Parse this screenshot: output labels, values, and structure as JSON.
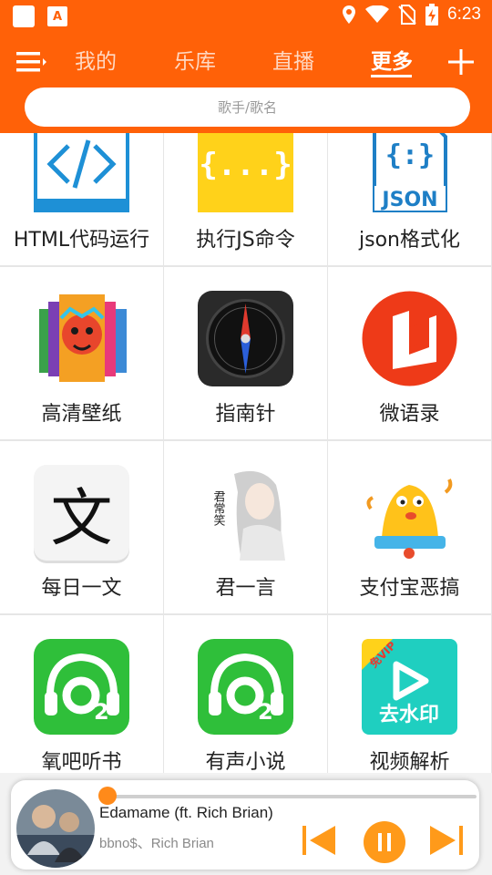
{
  "colors": {
    "brand": "#ff6108",
    "accent": "#ff9a1a"
  },
  "status_bar": {
    "time": "6:23",
    "icons": [
      "location-icon",
      "wifi-icon",
      "no-sim-icon",
      "battery-charging-icon"
    ]
  },
  "nav": {
    "tabs": [
      {
        "label": "我的"
      },
      {
        "label": "乐库"
      },
      {
        "label": "直播"
      },
      {
        "label": "更多",
        "active": true
      }
    ]
  },
  "search": {
    "placeholder": "歌手/歌名"
  },
  "apps": [
    {
      "label": "HTML代码运行",
      "icon": "html-code-icon"
    },
    {
      "label": "执行JS命令",
      "icon": "js-braces-icon"
    },
    {
      "label": "json格式化",
      "icon": "json-file-icon"
    },
    {
      "label": "高清壁纸",
      "icon": "wallpaper-icon"
    },
    {
      "label": "指南针",
      "icon": "compass-icon"
    },
    {
      "label": "微语录",
      "icon": "quotes-icon"
    },
    {
      "label": "每日一文",
      "icon": "wen-character-icon"
    },
    {
      "label": "君一言",
      "icon": "junxiao-portrait-icon"
    },
    {
      "label": "支付宝恶搞",
      "icon": "bell-cartoon-icon"
    },
    {
      "label": "氧吧听书",
      "icon": "headphones-o2-icon"
    },
    {
      "label": "有声小说",
      "icon": "headphones-o2-icon"
    },
    {
      "label": "视频解析",
      "icon": "watermark-remove-icon"
    }
  ],
  "icon_text": {
    "json": "JSON",
    "js": "{...}",
    "watermark": "去水印",
    "vip": "免VIP",
    "wen": "文",
    "portrait": "君常笑"
  },
  "player": {
    "song": "Edamame (ft. Rich Brian)",
    "artist": "bbno$、Rich Brian",
    "progress": 0.02,
    "state": "playing"
  }
}
